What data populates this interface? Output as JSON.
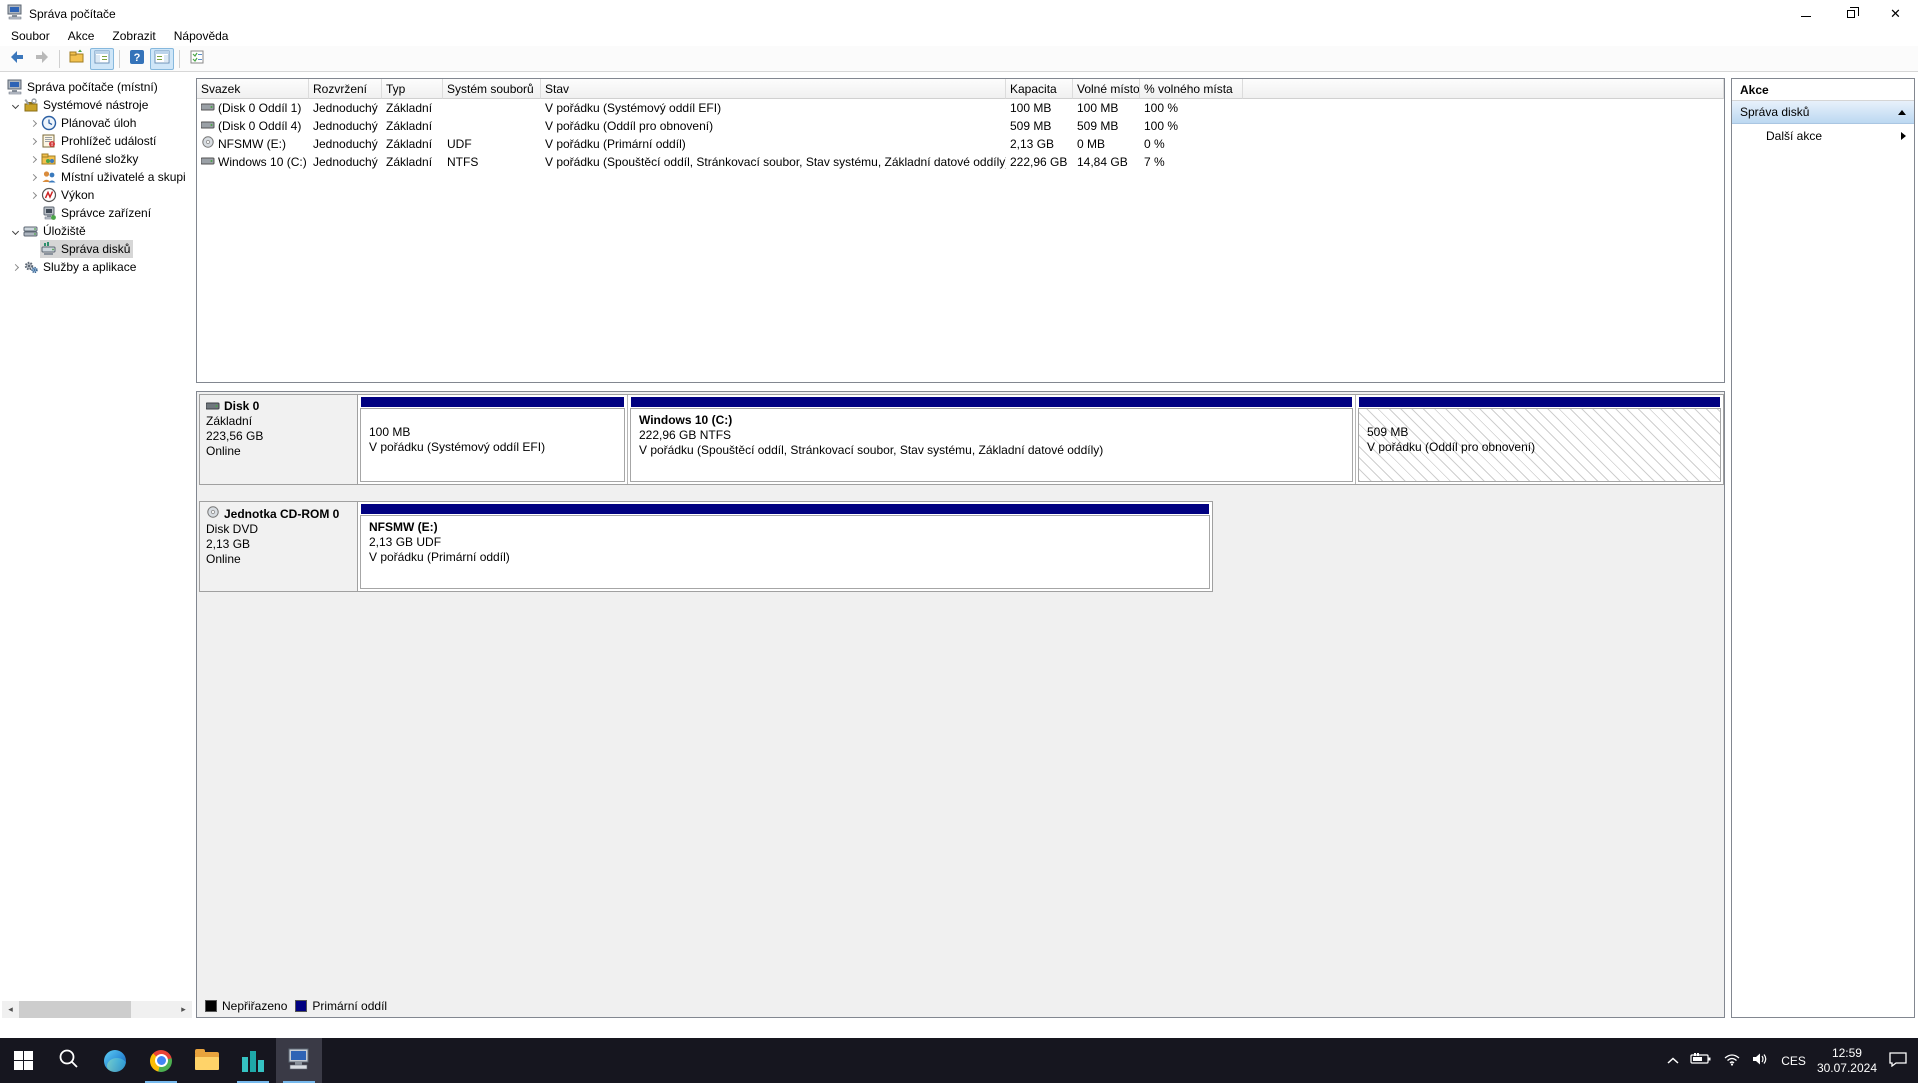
{
  "window": {
    "title": "Správa počítače"
  },
  "menubar": {
    "items": [
      "Soubor",
      "Akce",
      "Zobrazit",
      "Nápověda"
    ]
  },
  "toolbar": {
    "icons": [
      "back-icon",
      "forward-icon",
      "export-list-icon",
      "console-tree-toggle-icon",
      "help-icon",
      "action-pane-toggle-icon",
      "properties-icon"
    ]
  },
  "tree": {
    "items": [
      {
        "label": "Správa počítače (místní)",
        "icon": "computer-icon"
      },
      {
        "label": "Systémové nástroje",
        "icon": "system-tools-icon"
      },
      {
        "label": "Plánovač úloh",
        "icon": "task-scheduler-icon"
      },
      {
        "label": "Prohlížeč událostí",
        "icon": "event-viewer-icon"
      },
      {
        "label": "Sdílené složky",
        "icon": "shared-folders-icon"
      },
      {
        "label": "Místní uživatelé a skupi",
        "icon": "local-users-icon"
      },
      {
        "label": "Výkon",
        "icon": "performance-icon"
      },
      {
        "label": "Správce zařízení",
        "icon": "device-manager-icon"
      },
      {
        "label": "Úložiště",
        "icon": "storage-icon"
      },
      {
        "label": "Správa disků",
        "icon": "disk-management-icon",
        "selected": true
      },
      {
        "label": "Služby a aplikace",
        "icon": "services-icon"
      }
    ]
  },
  "volume_list": {
    "columns": [
      "Svazek",
      "Rozvržení",
      "Typ",
      "Systém souborů",
      "Stav",
      "Kapacita",
      "Volné místo",
      "% volného místa"
    ],
    "rows": [
      {
        "name": "(Disk 0 Oddíl 1)",
        "layout": "Jednoduchý",
        "type": "Základní",
        "fs": "",
        "status": "V pořádku (Systémový oddíl EFI)",
        "capacity": "100 MB",
        "free": "100 MB",
        "free_pct": "100 %"
      },
      {
        "name": "(Disk 0 Oddíl 4)",
        "layout": "Jednoduchý",
        "type": "Základní",
        "fs": "",
        "status": "V pořádku (Oddíl pro obnovení)",
        "capacity": "509 MB",
        "free": "509 MB",
        "free_pct": "100 %"
      },
      {
        "name": "NFSMW (E:)",
        "layout": "Jednoduchý",
        "type": "Základní",
        "fs": "UDF",
        "status": "V pořádku (Primární oddíl)",
        "capacity": "2,13 GB",
        "free": "0 MB",
        "free_pct": "0 %"
      },
      {
        "name": "Windows 10 (C:)",
        "layout": "Jednoduchý",
        "type": "Základní",
        "fs": "NTFS",
        "status": "V pořádku (Spouštěcí oddíl, Stránkovací soubor, Stav systému, Základní datové oddíly)",
        "capacity": "222,96 GB",
        "free": "14,84 GB",
        "free_pct": "7 %"
      }
    ]
  },
  "disks": [
    {
      "name": "Disk 0",
      "type": "Základní",
      "size": "223,56 GB",
      "status": "Online",
      "partitions": [
        {
          "title": "",
          "size": "100 MB",
          "status": "V pořádku (Systémový oddíl EFI)"
        },
        {
          "title": "Windows 10 (C:)",
          "size": "222,96 GB NTFS",
          "status": "V pořádku (Spouštěcí oddíl, Stránkovací soubor, Stav systému, Základní datové oddíly)"
        },
        {
          "title": "",
          "size": "509 MB",
          "status": "V pořádku (Oddíl pro obnovení)"
        }
      ]
    },
    {
      "name": "Jednotka CD-ROM 0",
      "type": "Disk DVD",
      "size": "2,13 GB",
      "status": "Online",
      "partitions": [
        {
          "title": "NFSMW (E:)",
          "size": "2,13 GB UDF",
          "status": "V pořádku (Primární oddíl)"
        }
      ]
    }
  ],
  "legend": {
    "unallocated_label": "Nepřiřazeno",
    "primary_label": "Primární oddíl",
    "unallocated_color": "#000000",
    "primary_color": "#000080"
  },
  "actions": {
    "header": "Akce",
    "group_title": "Správa disků",
    "more_actions": "Další akce"
  },
  "taskbar": {
    "icons": [
      "start",
      "search",
      "edge",
      "chrome",
      "file-explorer",
      "buildings-app",
      "computer-management"
    ],
    "tray": {
      "lang": "CES",
      "time": "12:59",
      "date": "30.07.2024"
    }
  }
}
